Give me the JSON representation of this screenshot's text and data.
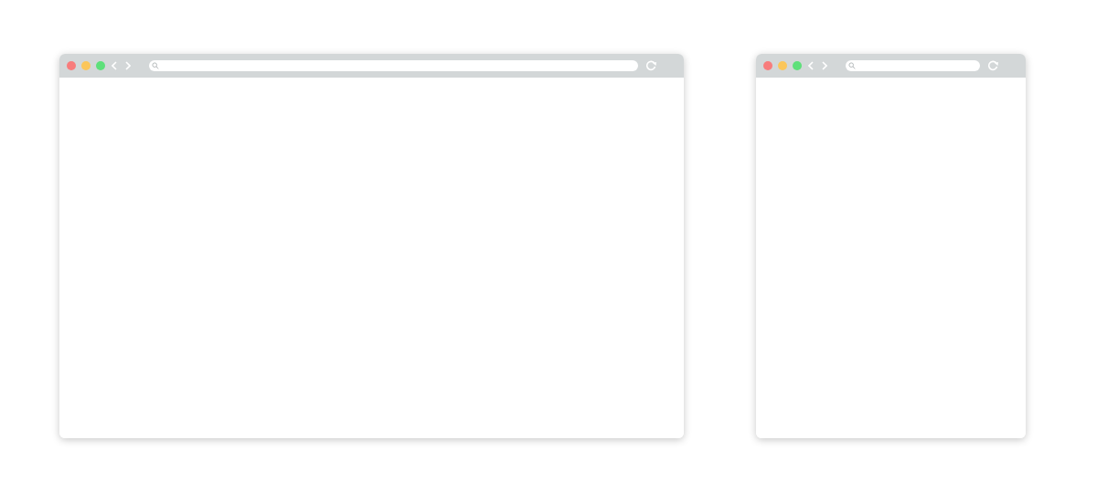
{
  "windows": [
    {
      "kind": "wide"
    },
    {
      "kind": "narrow"
    }
  ]
}
